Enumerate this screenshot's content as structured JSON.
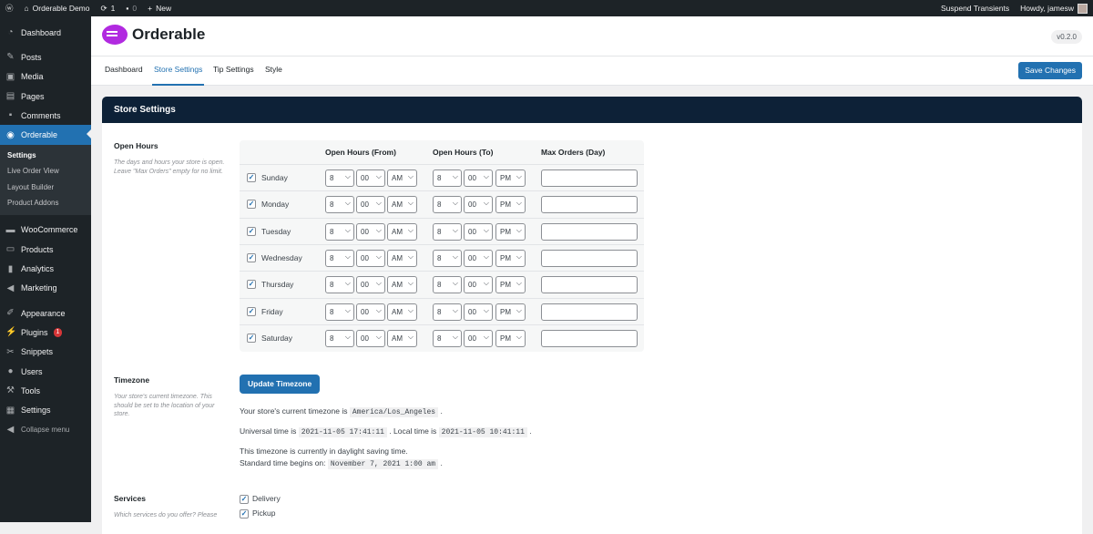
{
  "adminbar": {
    "site": "Orderable Demo",
    "updates": "1",
    "comments": "0",
    "new": "New",
    "suspend": "Suspend Transients",
    "howdy": "Howdy, jamesw"
  },
  "sidebar": {
    "items": [
      {
        "label": "Dashboard",
        "icon": "dashboard-icon"
      },
      {
        "label": "Posts",
        "icon": "pin-icon"
      },
      {
        "label": "Media",
        "icon": "media-icon"
      },
      {
        "label": "Pages",
        "icon": "pages-icon"
      },
      {
        "label": "Comments",
        "icon": "comment-icon"
      },
      {
        "label": "Orderable",
        "icon": "orderable-icon",
        "active": true
      },
      {
        "label": "WooCommerce",
        "icon": "woocommerce-icon"
      },
      {
        "label": "Products",
        "icon": "archive-icon"
      },
      {
        "label": "Analytics",
        "icon": "bar-chart-icon"
      },
      {
        "label": "Marketing",
        "icon": "megaphone-icon"
      },
      {
        "label": "Appearance",
        "icon": "brush-icon"
      },
      {
        "label": "Plugins",
        "icon": "plug-icon",
        "badge": "1"
      },
      {
        "label": "Snippets",
        "icon": "scissors-icon"
      },
      {
        "label": "Users",
        "icon": "user-icon"
      },
      {
        "label": "Tools",
        "icon": "wrench-icon"
      },
      {
        "label": "Settings",
        "icon": "sliders-icon"
      },
      {
        "label": "Collapse menu",
        "icon": "collapse-icon"
      }
    ],
    "submenu": [
      "Settings",
      "Live Order View",
      "Layout Builder",
      "Product Addons"
    ]
  },
  "header": {
    "brand": "Orderable",
    "version": "v0.2.0"
  },
  "tabs": [
    "Dashboard",
    "Store Settings",
    "Tip Settings",
    "Style"
  ],
  "active_tab": "Store Settings",
  "save_label": "Save Changes",
  "card": {
    "title": "Store Settings"
  },
  "open_hours": {
    "label": "Open Hours",
    "desc": "The days and hours your store is open. Leave \"Max Orders\" empty for no limit.",
    "headers": [
      "Open Hours (From)",
      "Open Hours (To)",
      "Max Orders (Day)"
    ],
    "days": [
      {
        "day": "Sunday",
        "checked": true,
        "from": [
          "8",
          "00",
          "AM"
        ],
        "to": [
          "8",
          "00",
          "PM"
        ],
        "max": ""
      },
      {
        "day": "Monday",
        "checked": true,
        "from": [
          "8",
          "00",
          "AM"
        ],
        "to": [
          "8",
          "00",
          "PM"
        ],
        "max": ""
      },
      {
        "day": "Tuesday",
        "checked": true,
        "from": [
          "8",
          "00",
          "AM"
        ],
        "to": [
          "8",
          "00",
          "PM"
        ],
        "max": ""
      },
      {
        "day": "Wednesday",
        "checked": true,
        "from": [
          "8",
          "00",
          "AM"
        ],
        "to": [
          "8",
          "00",
          "PM"
        ],
        "max": ""
      },
      {
        "day": "Thursday",
        "checked": true,
        "from": [
          "8",
          "00",
          "AM"
        ],
        "to": [
          "8",
          "00",
          "PM"
        ],
        "max": ""
      },
      {
        "day": "Friday",
        "checked": true,
        "from": [
          "8",
          "00",
          "AM"
        ],
        "to": [
          "8",
          "00",
          "PM"
        ],
        "max": ""
      },
      {
        "day": "Saturday",
        "checked": true,
        "from": [
          "8",
          "00",
          "AM"
        ],
        "to": [
          "8",
          "00",
          "PM"
        ],
        "max": ""
      }
    ]
  },
  "timezone": {
    "label": "Timezone",
    "desc": "Your store's current timezone. This should be set to the location of your store.",
    "button": "Update Timezone",
    "current_prefix": "Your store's current timezone is",
    "current": "America/Los_Angeles",
    "utc_prefix": "Universal time is",
    "utc": "2021-11-05 17:41:11",
    "local_prefix": ". Local time is",
    "local": "2021-11-05 10:41:11",
    "dst": "This timezone is currently in daylight saving time.",
    "std_prefix": "Standard time begins on:",
    "std": "November 7, 2021 1:00 am"
  },
  "services": {
    "label": "Services",
    "desc": "Which services do you offer? Please",
    "options": [
      {
        "label": "Delivery",
        "checked": true
      },
      {
        "label": "Pickup",
        "checked": true
      }
    ]
  },
  "colors": {
    "accent": "#2271b1",
    "sidebar": "#1d2327",
    "card_header": "#0d2137",
    "brand": "#b12ae0"
  }
}
